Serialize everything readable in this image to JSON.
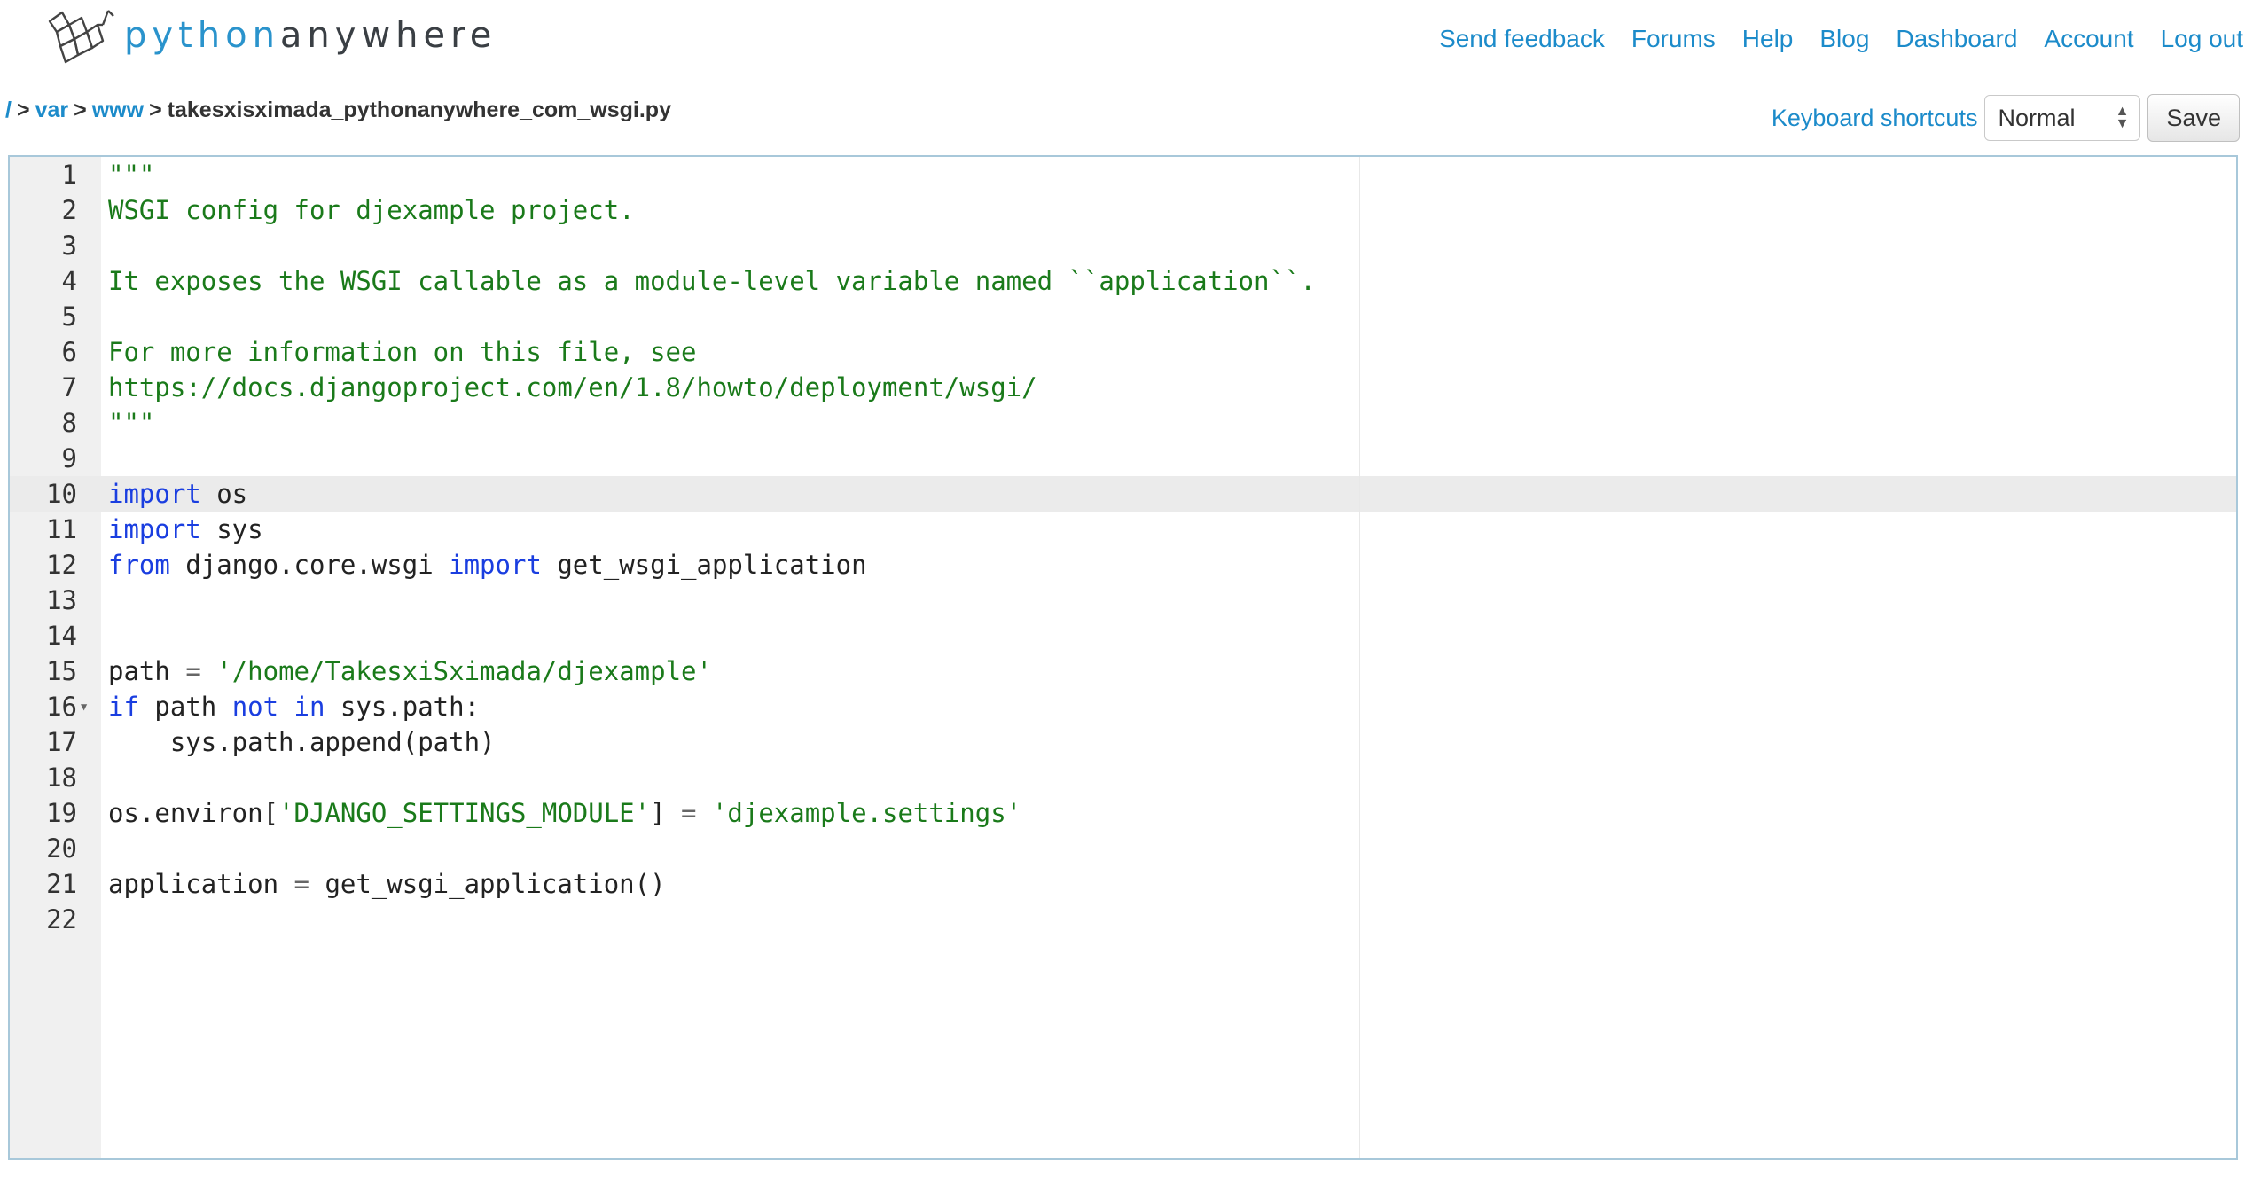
{
  "logo": {
    "part1": "python",
    "part2": "anywhere"
  },
  "nav": [
    "Send feedback",
    "Forums",
    "Help",
    "Blog",
    "Dashboard",
    "Account",
    "Log out"
  ],
  "breadcrumb": {
    "root": "/",
    "sep": ">",
    "parts": [
      "var",
      "www"
    ],
    "file": "takesxisximada_pythonanywhere_com_wsgi.py"
  },
  "toolbar": {
    "keyboard_label": "Keyboard shortcuts",
    "mode_selected": "Normal",
    "save_label": "Save"
  },
  "colors": {
    "link": "#1c8bca",
    "string": "#1a7a1a",
    "keyword": "#1a3ee0",
    "editor_border": "#a8c8da"
  },
  "editor": {
    "active_line": 10,
    "fold_line": 16,
    "lines": [
      [
        [
          "str",
          "\"\"\""
        ]
      ],
      [
        [
          "str",
          "WSGI config for djexample project."
        ]
      ],
      [],
      [
        [
          "str",
          "It exposes the WSGI callable as a module-level variable named ``application``."
        ]
      ],
      [],
      [
        [
          "str",
          "For more information on this file, see"
        ]
      ],
      [
        [
          "str",
          "https://docs.djangoproject.com/en/1.8/howto/deployment/wsgi/"
        ]
      ],
      [
        [
          "str",
          "\"\"\""
        ]
      ],
      [],
      [
        [
          "kw",
          "import"
        ],
        [
          "txt",
          " os"
        ]
      ],
      [
        [
          "kw",
          "import"
        ],
        [
          "txt",
          " sys"
        ]
      ],
      [
        [
          "kw",
          "from"
        ],
        [
          "txt",
          " django.core.wsgi "
        ],
        [
          "kw",
          "import"
        ],
        [
          "txt",
          " get_wsgi_application"
        ]
      ],
      [],
      [],
      [
        [
          "txt",
          "path "
        ],
        [
          "op",
          "="
        ],
        [
          "txt",
          " "
        ],
        [
          "str",
          "'/home/TakesxiSximada/djexample'"
        ]
      ],
      [
        [
          "kw",
          "if"
        ],
        [
          "txt",
          " path "
        ],
        [
          "kw",
          "not"
        ],
        [
          "txt",
          " "
        ],
        [
          "kw",
          "in"
        ],
        [
          "txt",
          " sys.path:"
        ]
      ],
      [
        [
          "txt",
          "    sys.path.append(path)"
        ]
      ],
      [],
      [
        [
          "txt",
          "os.environ["
        ],
        [
          "str",
          "'DJANGO_SETTINGS_MODULE'"
        ],
        [
          "txt",
          "] "
        ],
        [
          "op",
          "="
        ],
        [
          "txt",
          " "
        ],
        [
          "str",
          "'djexample.settings'"
        ]
      ],
      [],
      [
        [
          "txt",
          "application "
        ],
        [
          "op",
          "="
        ],
        [
          "txt",
          " get_wsgi_application()"
        ]
      ],
      []
    ]
  }
}
